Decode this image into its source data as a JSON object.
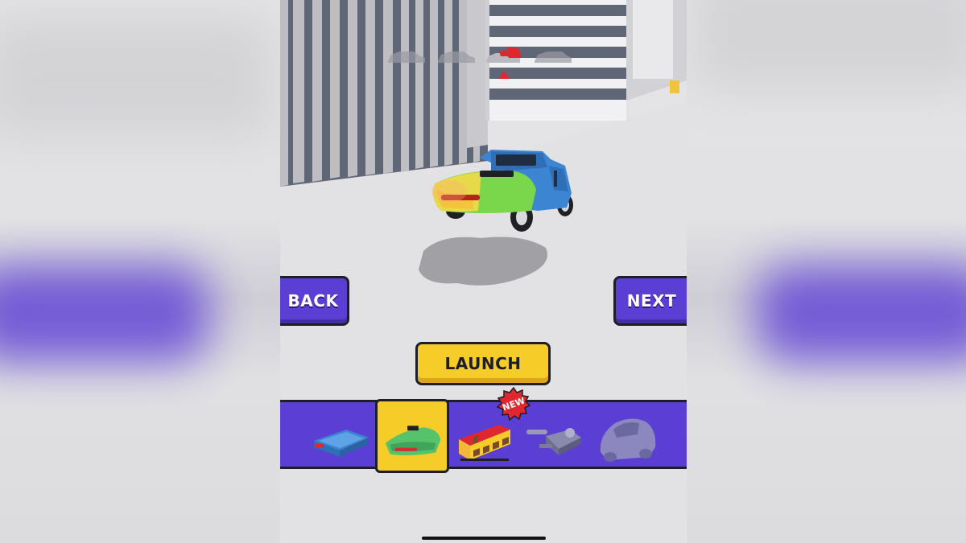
{
  "game": {
    "buttons": {
      "back": "BACK",
      "next": "NEXT",
      "launch": "LAUNCH"
    },
    "badge": "NEW",
    "progress": {
      "icons": [
        "car-silhouette-icon",
        "car-silhouette-icon",
        "car-current-icon",
        "car-silhouette-icon"
      ],
      "current_index": 2
    },
    "parts": [
      {
        "name": "truck-bed-part",
        "icon": "truck-bed-icon",
        "selected": false
      },
      {
        "name": "car-rear-part",
        "icon": "car-rear-icon",
        "selected": true
      },
      {
        "name": "tram-part",
        "icon": "tram-icon",
        "selected": false,
        "new": true
      },
      {
        "name": "engine-part",
        "icon": "engine-icon",
        "selected": false
      },
      {
        "name": "bubble-car-part",
        "icon": "bubble-car-icon",
        "selected": false,
        "locked": true
      }
    ],
    "colors": {
      "primary": "#5b3fd4",
      "accent": "#f6cc29",
      "outline": "#1e1e28",
      "badge": "#e0262e"
    }
  }
}
